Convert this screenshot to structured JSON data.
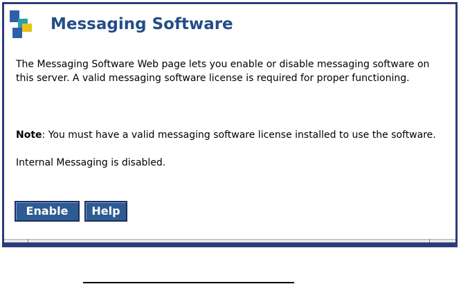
{
  "page": {
    "title": "Messaging Software",
    "description": "The Messaging Software Web page lets you enable or disable messaging software on this server. A valid messaging software license is required for proper functioning.",
    "note_label": "Note",
    "note_text": ": You must have a valid messaging software license installed to use the software.",
    "status_text": "Internal Messaging is disabled."
  },
  "buttons": {
    "enable_label": "Enable",
    "help_label": "Help"
  },
  "colors": {
    "title": "#244d88",
    "button_bg": "#2e5b93",
    "frame": "#2b3b7a",
    "logo_blue": "#2f5fa8",
    "logo_teal": "#2aa0a8",
    "logo_yellow": "#e8c21a"
  },
  "icons": {
    "logo": "product-logo-icon"
  }
}
